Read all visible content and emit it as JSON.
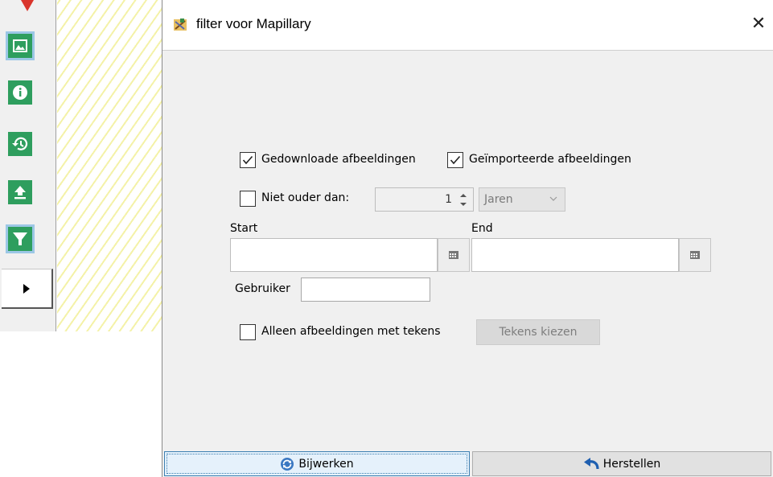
{
  "dialog": {
    "title": "filter voor Mapillary",
    "close_icon": "close-icon"
  },
  "filters": {
    "downloaded_label": "Gedownloade afbeeldingen",
    "downloaded_checked": true,
    "imported_label": "Geïmporteerde afbeeldingen",
    "imported_checked": true,
    "not_older_label": "Niet ouder dan:",
    "not_older_checked": false,
    "not_older_value": "1",
    "not_older_unit": "Jaren",
    "start_label": "Start",
    "start_value": "",
    "end_label": "End",
    "end_value": "",
    "user_label": "Gebruiker",
    "user_value": "",
    "signs_only_label": "Alleen afbeeldingen met tekens",
    "signs_only_checked": false,
    "choose_signs_label": "Tekens kiezen"
  },
  "footer": {
    "update_label": "Bijwerken",
    "reset_label": "Herstellen"
  },
  "toolbar": {
    "items": [
      "image-icon",
      "info-icon",
      "history-icon",
      "upload-icon",
      "filter-icon"
    ],
    "selected": [
      "image-icon",
      "filter-icon"
    ],
    "accent": "#2e9e5e"
  }
}
